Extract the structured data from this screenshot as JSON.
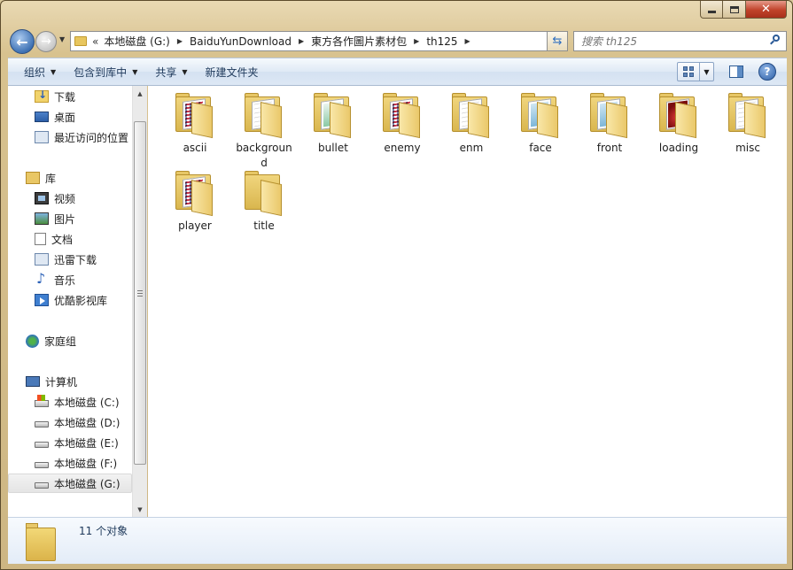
{
  "window": {
    "caption": {
      "minimize": "—",
      "maximize": "□",
      "close": "✕"
    }
  },
  "address": {
    "more": "«",
    "crumbs": [
      "本地磁盘 (G:)",
      "BaiduYunDownload",
      "東方各作圖片素材包",
      "th125"
    ]
  },
  "search": {
    "placeholder": "搜索 th125"
  },
  "toolbar": {
    "organize": "组织",
    "include_library": "包含到库中",
    "share": "共享",
    "new_folder": "新建文件夹"
  },
  "nav": {
    "favorites": [
      {
        "label": "下载",
        "icon": "download-folder-icon"
      },
      {
        "label": "桌面",
        "icon": "desktop-icon"
      },
      {
        "label": "最近访问的位置",
        "icon": "recent-places-icon"
      }
    ],
    "libraries_label": "库",
    "libraries": [
      {
        "label": "视频",
        "icon": "video-library-icon"
      },
      {
        "label": "图片",
        "icon": "picture-library-icon"
      },
      {
        "label": "文档",
        "icon": "document-library-icon"
      },
      {
        "label": "迅雷下载",
        "icon": "xunlei-library-icon"
      },
      {
        "label": "音乐",
        "icon": "music-library-icon"
      },
      {
        "label": "优酷影视库",
        "icon": "youku-library-icon"
      }
    ],
    "homegroup_label": "家庭组",
    "computer_label": "计算机",
    "drives": [
      {
        "label": "本地磁盘 (C:)",
        "icon": "system-drive-icon"
      },
      {
        "label": "本地磁盘 (D:)",
        "icon": "drive-icon"
      },
      {
        "label": "本地磁盘 (E:)",
        "icon": "drive-icon"
      },
      {
        "label": "本地磁盘 (F:)",
        "icon": "drive-icon"
      },
      {
        "label": "本地磁盘 (G:)",
        "icon": "drive-icon",
        "selected": true
      }
    ]
  },
  "files": [
    {
      "name": "ascii",
      "thumb": "grid"
    },
    {
      "name": "background",
      "thumb": "light"
    },
    {
      "name": "bullet",
      "thumb": "green"
    },
    {
      "name": "enemy",
      "thumb": "grid"
    },
    {
      "name": "enm",
      "thumb": "light"
    },
    {
      "name": "face",
      "thumb": "blue"
    },
    {
      "name": "front",
      "thumb": "blue"
    },
    {
      "name": "loading",
      "thumb": "red"
    },
    {
      "name": "misc",
      "thumb": "light"
    },
    {
      "name": "player",
      "thumb": "grid"
    },
    {
      "name": "title",
      "thumb": "none"
    }
  ],
  "details": {
    "count_text": "11 个对象"
  }
}
